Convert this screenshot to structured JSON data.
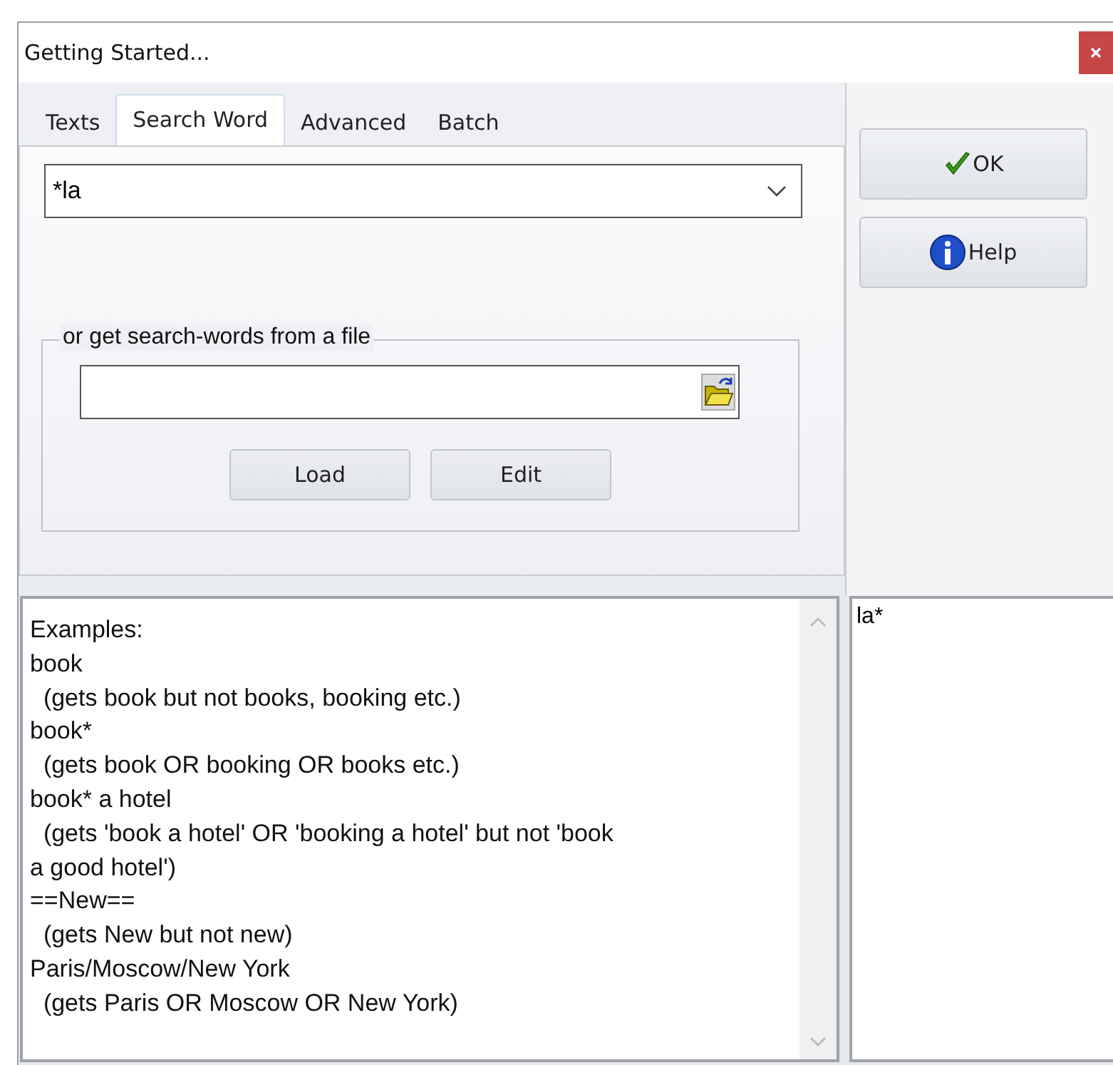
{
  "window": {
    "title": "Getting Started..."
  },
  "tabs": [
    {
      "label": "Texts",
      "selected": false
    },
    {
      "label": "Search Word",
      "selected": true
    },
    {
      "label": "Advanced",
      "selected": false
    },
    {
      "label": "Batch",
      "selected": false
    }
  ],
  "search_word": {
    "value": "*la"
  },
  "file_group": {
    "legend": "or get search-words from a file",
    "buttons": [
      "Load",
      "Edit"
    ]
  },
  "buttons": [
    {
      "label": "OK",
      "kind": "ok"
    },
    {
      "label": "Help",
      "kind": "help"
    }
  ],
  "examples": [
    "Examples:",
    "book",
    "  (gets book but not books, booking etc.)",
    "book*",
    "  (gets book OR booking OR books etc.)",
    "book* a hotel",
    "  (gets 'book a hotel' OR 'booking a hotel' but not 'book",
    "a good hotel')",
    "==New==",
    "  (gets New but not new)",
    "Paris/Moscow/New York",
    "  (gets Paris OR Moscow OR New York)"
  ],
  "word_list": [
    "la*"
  ]
}
